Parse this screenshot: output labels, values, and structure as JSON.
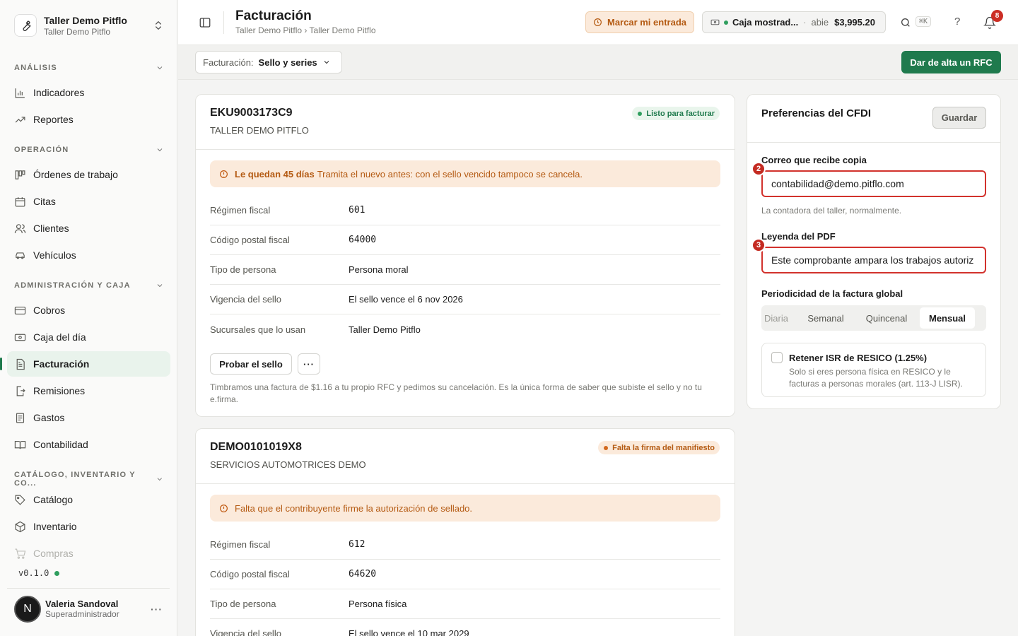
{
  "workspace": {
    "name": "Taller Demo Pitflo",
    "subtitle": "Taller Demo Pitflo"
  },
  "sidebar": {
    "sections": [
      {
        "label": "ANÁLISIS"
      },
      {
        "label": "OPERACIÓN"
      },
      {
        "label": "ADMINISTRACIÓN Y CAJA"
      },
      {
        "label": "CATÁLOGO, INVENTARIO Y CO..."
      }
    ],
    "items": [
      {
        "label": "Indicadores",
        "icon": "bar-chart-icon"
      },
      {
        "label": "Reportes",
        "icon": "trend-icon"
      },
      {
        "label": "Órdenes de trabajo",
        "icon": "kanban-icon"
      },
      {
        "label": "Citas",
        "icon": "calendar-icon"
      },
      {
        "label": "Clientes",
        "icon": "users-icon"
      },
      {
        "label": "Vehículos",
        "icon": "car-icon"
      },
      {
        "label": "Cobros",
        "icon": "card-icon"
      },
      {
        "label": "Caja del día",
        "icon": "cash-icon"
      },
      {
        "label": "Facturación",
        "icon": "receipt-icon",
        "active": true
      },
      {
        "label": "Remisiones",
        "icon": "file-export-icon"
      },
      {
        "label": "Gastos",
        "icon": "ledger-icon"
      },
      {
        "label": "Contabilidad",
        "icon": "book-icon"
      },
      {
        "label": "Catálogo",
        "icon": "tag-icon"
      },
      {
        "label": "Inventario",
        "icon": "box-icon"
      },
      {
        "label": "Compras",
        "icon": "cart-icon"
      }
    ],
    "version": "v0.1.0"
  },
  "user": {
    "initial": "N",
    "name": "Valeria Sandoval",
    "role": "Superadministrador"
  },
  "header": {
    "title": "Facturación",
    "breadcrumb": "Taller Demo Pitflo › Taller Demo Pitflo",
    "clock_in_label": "Marcar mi entrada",
    "register": {
      "name": "Caja mostrad...",
      "separator": "·",
      "status": "abie",
      "amount": "$3,995.20"
    },
    "search_shortcut": "⌘K",
    "help": "?",
    "notifications": "8"
  },
  "toolbar": {
    "selector_label": "Facturación:",
    "selector_value": "Sello y series",
    "add_rfc_label": "Dar de alta un RFC"
  },
  "emitters": [
    {
      "rfc": "EKU9003173C9",
      "name": "TALLER DEMO PITFLO",
      "status": "Listo para facturar",
      "alert_bold": "Le quedan 45 días",
      "alert_text": "Tramita el nuevo antes: con el sello vencido tampoco se cancela.",
      "rows": [
        {
          "label": "Régimen fiscal",
          "value": "601"
        },
        {
          "label": "Código postal fiscal",
          "value": "64000"
        },
        {
          "label": "Tipo de persona",
          "value": "Persona moral"
        },
        {
          "label": "Vigencia del sello",
          "value": "El sello vence el 6 nov 2026"
        },
        {
          "label": "Sucursales que lo usan",
          "value": "Taller Demo Pitflo"
        }
      ],
      "test_button": "Probar el sello",
      "more_button": "···",
      "note": "Timbramos una factura de $1.16 a tu propio RFC y pedimos su cancelación. Es la única forma de saber que subiste el sello y no tu e.firma."
    },
    {
      "rfc": "DEMO0101019X8",
      "name": "SERVICIOS AUTOMOTRICES DEMO",
      "status": "Falta la firma del manifiesto",
      "alert_text": "Falta que el contribuyente firme la autorización de sellado.",
      "rows": [
        {
          "label": "Régimen fiscal",
          "value": "612"
        },
        {
          "label": "Código postal fiscal",
          "value": "64620"
        },
        {
          "label": "Tipo de persona",
          "value": "Persona física"
        },
        {
          "label": "Vigencia del sello",
          "value": "El sello vence el 10 mar 2029"
        }
      ]
    }
  ],
  "preferences": {
    "title": "Preferencias del CFDI",
    "save_label": "Guardar",
    "email_label": "Correo que recibe copia",
    "email_value": "contabilidad@demo.pitflo.com",
    "email_help": "La contadora del taller, normalmente.",
    "email_marker": "2",
    "legend_label": "Leyenda del PDF",
    "legend_value": "Este comprobante ampara los trabajos autoriz",
    "legend_marker": "3",
    "periodicity_label": "Periodicidad de la factura global",
    "periodicity_options": [
      "Diaria",
      "Semanal",
      "Quincenal",
      "Mensual"
    ],
    "periodicity_selected": "Mensual",
    "resico_title": "Retener ISR de RESICO (1.25%)",
    "resico_desc": "Solo si eres persona física en RESICO y le facturas a personas morales (art. 113-J LISR).",
    "resico_checked": false
  },
  "colors": {
    "brand_green": "#1f7a4d",
    "warning": "#b45a12",
    "marker_red": "#c42b22"
  }
}
